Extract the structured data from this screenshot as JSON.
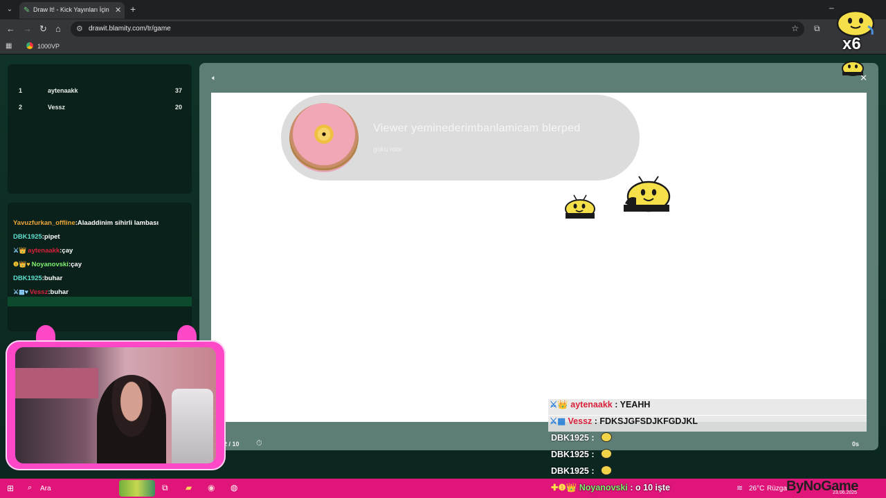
{
  "browser": {
    "tab_title": "Draw It! - Kick Yayınları İçin Çiz",
    "url": "drawit.blamity.com/tr/game",
    "bookmark": "1000VP"
  },
  "leaderboard": [
    {
      "rank": "1",
      "name": "aytenaakk",
      "score": "37"
    },
    {
      "rank": "2",
      "name": "Vessz",
      "score": "20"
    }
  ],
  "chat": [
    {
      "badges": "",
      "user": "Yavuzfurkan_offline",
      "user_color": "#f0a93a",
      "text": "Alaaddinim sihirli lambası"
    },
    {
      "badges": "",
      "user": "DBK1925",
      "user_color": "#5ee0d0",
      "text": "pipet"
    },
    {
      "badges": "⚔👑",
      "user": "aytenaakk",
      "user_color": "#d8203a",
      "text": "çay"
    },
    {
      "badges": "❶👑♥",
      "user": "Noyanovski",
      "user_color": "#7df06f",
      "text": "çay"
    },
    {
      "badges": "",
      "user": "DBK1925",
      "user_color": "#5ee0d0",
      "text": "buhar"
    },
    {
      "badges": "⚔▦♥",
      "user": "Vessz",
      "user_color": "#d8203a",
      "text": "buhar"
    }
  ],
  "notification": {
    "title": "Viewer yeminederimbanlamicam blerped",
    "subtitle": "goku roar"
  },
  "game": {
    "round": "2 / 10",
    "seconds": "0s"
  },
  "overlay_chat": [
    {
      "user": "aytenaakk",
      "sep": " : ",
      "text": "YEAHH",
      "style": "light",
      "user_class": "ov-user-red"
    },
    {
      "user": "Vessz",
      "sep": " : ",
      "text": "FDKSJGFSDJKFGDJKL",
      "style": "light",
      "user_class": "ov-user-red"
    },
    {
      "user": "DBK1925",
      "sep": " : ",
      "text": "",
      "style": "dark",
      "user_class": "ov-user-white"
    },
    {
      "user": "DBK1925",
      "sep": " : ",
      "text": "",
      "style": "dark",
      "user_class": "ov-user-white"
    },
    {
      "user": "DBK1925",
      "sep": " : ",
      "text": "",
      "style": "dark",
      "user_class": "ov-user-white"
    },
    {
      "user": "Noyanovski",
      "sep": " : ",
      "text": "o 10 işte",
      "style": "dark",
      "user_class": "ov-user-green"
    }
  ],
  "sticker": {
    "multiplier": "x6"
  },
  "taskbar": {
    "search": "Ara",
    "temperature": "26°C",
    "weather": "Rüzgar",
    "watermark": "ByNoGame",
    "date": "23.06.2025"
  },
  "colors": {
    "accent_pink": "#e0157a",
    "panel_teal": "#5d7e76",
    "page_green": "#0f3328"
  }
}
